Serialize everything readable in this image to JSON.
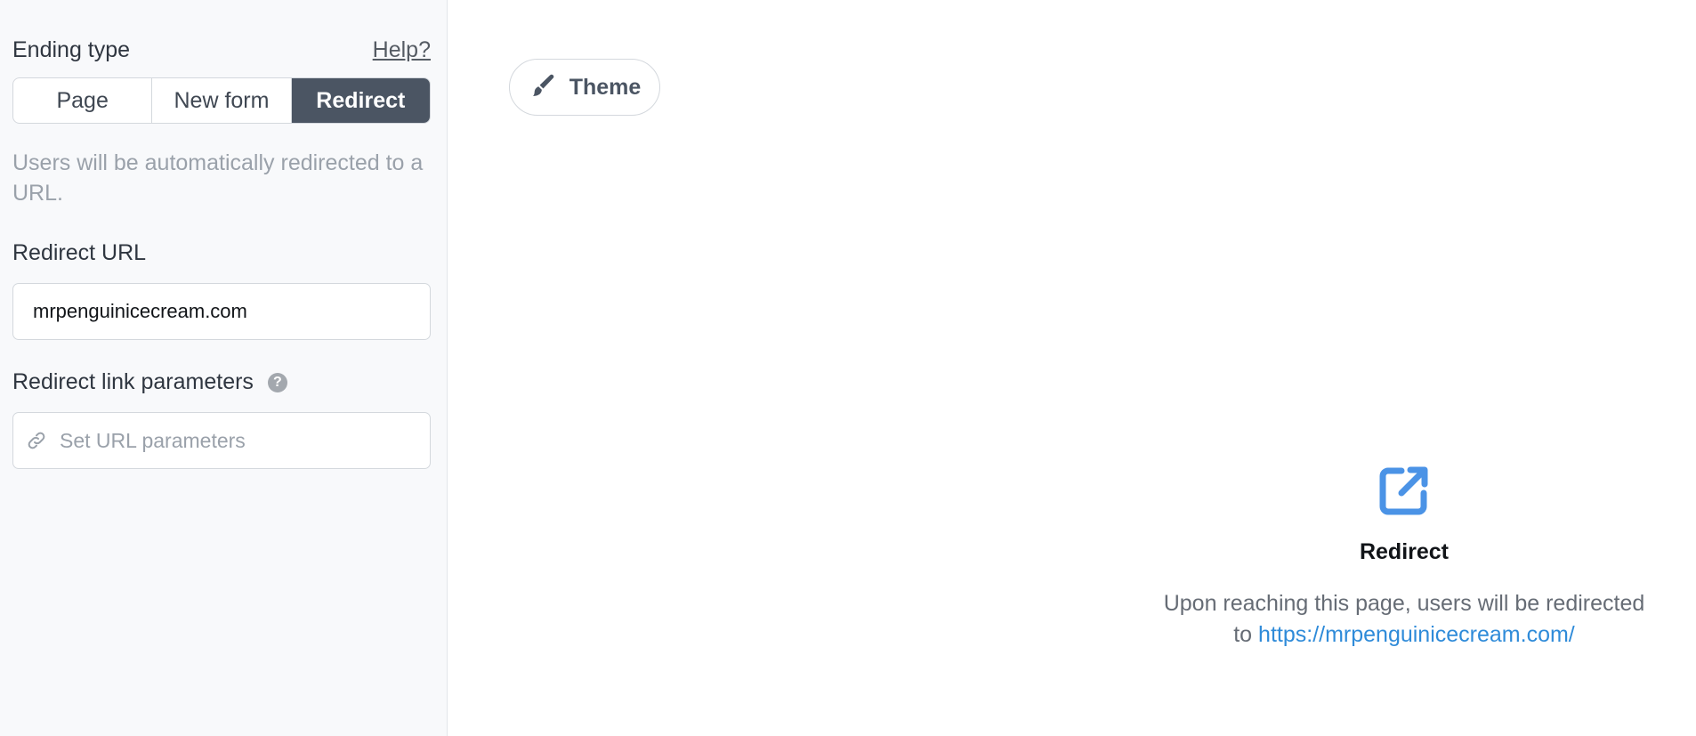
{
  "sidebar": {
    "section_title": "Ending type",
    "help_label": "Help?",
    "ending_types": [
      {
        "label": "Page",
        "active": false
      },
      {
        "label": "New form",
        "active": false
      },
      {
        "label": "Redirect",
        "active": true
      }
    ],
    "description": "Users will be automatically redirected to a URL.",
    "redirect_url": {
      "label": "Redirect URL",
      "value": "mrpenguinicecream.com"
    },
    "link_params": {
      "label": "Redirect link parameters",
      "help_icon": "question-icon",
      "placeholder": "Set URL parameters",
      "icon": "link-icon"
    }
  },
  "main": {
    "theme_button": {
      "label": "Theme",
      "icon": "paintbrush-icon"
    },
    "preview": {
      "icon": "external-link-icon",
      "title": "Redirect",
      "text": "Upon reaching this page, users will be redirected to",
      "link": "https://mrpenguinicecream.com/"
    }
  },
  "colors": {
    "accent_dark": "#4b5563",
    "link": "#2f8bd9",
    "icon_blue": "#4b93e6"
  }
}
